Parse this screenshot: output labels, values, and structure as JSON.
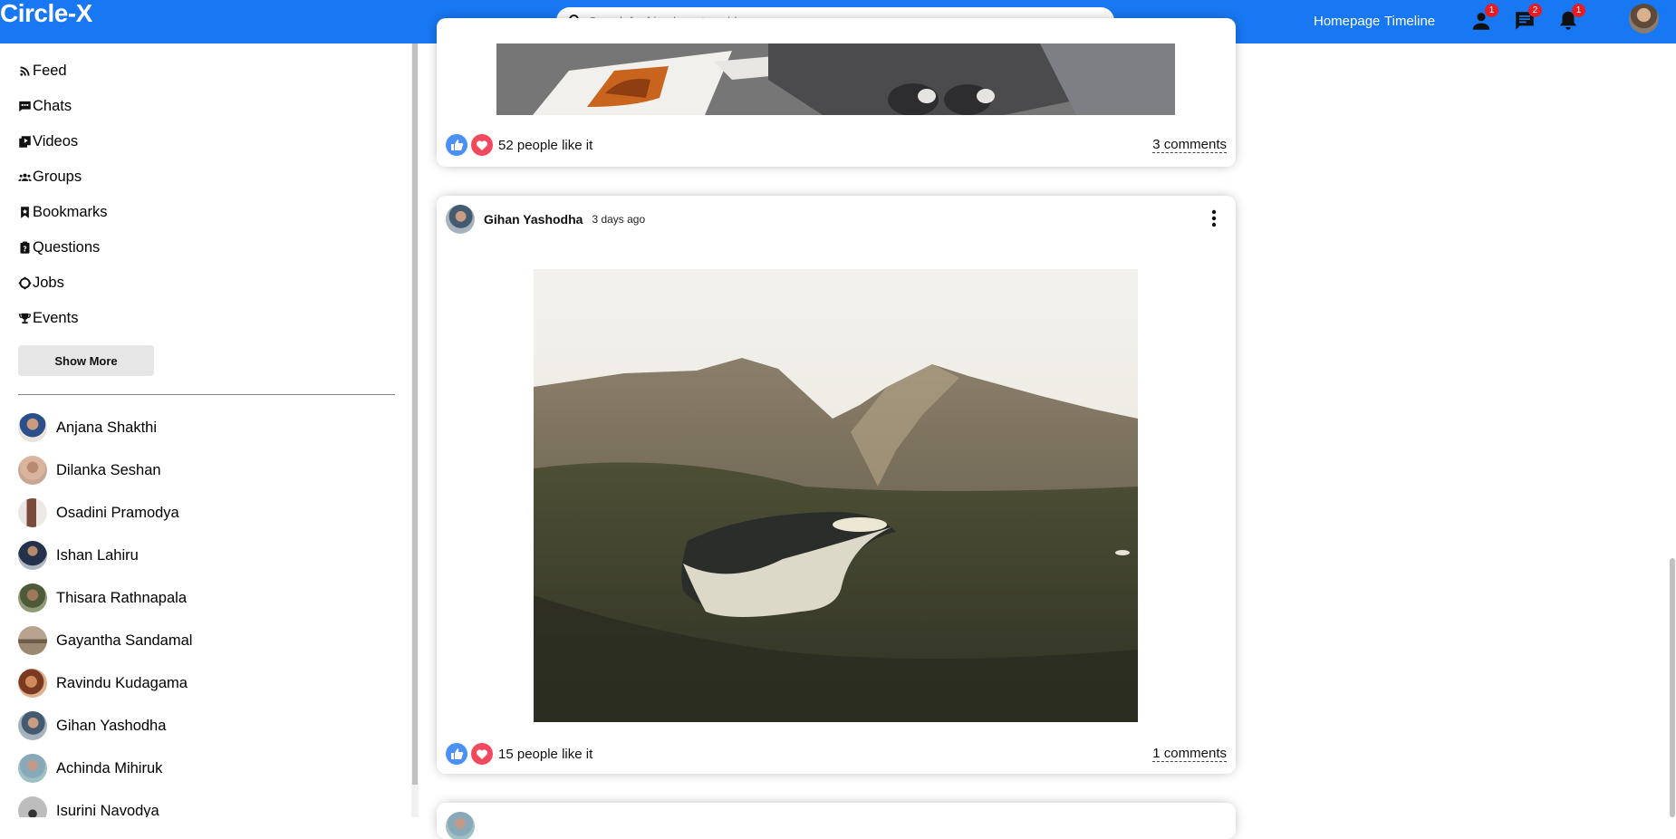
{
  "app": {
    "logo": "Circle-X"
  },
  "header": {
    "search_placeholder": "Search for friend, post or video",
    "links": [
      "Homepage",
      "Timeline"
    ],
    "badges": {
      "friends": "1",
      "messages": "2",
      "notifications": "1"
    },
    "icons": {
      "search": "search-icon",
      "friends": "person-icon",
      "messages": "chat-icon",
      "notifications": "bell-icon"
    }
  },
  "sidebar": {
    "nav": [
      {
        "label": "Feed",
        "icon": "rss-icon"
      },
      {
        "label": "Chats",
        "icon": "chat-icon"
      },
      {
        "label": "Videos",
        "icon": "video-library-icon"
      },
      {
        "label": "Groups",
        "icon": "group-icon"
      },
      {
        "label": "Bookmarks",
        "icon": "bookmark-icon"
      },
      {
        "label": "Questions",
        "icon": "question-icon"
      },
      {
        "label": "Jobs",
        "icon": "work-icon"
      },
      {
        "label": "Events",
        "icon": "trophy-icon"
      }
    ],
    "show_more_label": "Show More",
    "friends": [
      "Anjana Shakthi",
      "Dilanka Seshan",
      "Osadini Pramodya",
      "Ishan Lahiru",
      "Thisara Rathnapala",
      "Gayantha Sandamal",
      "Ravindu Kudagama",
      "Gihan Yashodha",
      "Achinda Mihiruk",
      "Isurini Navodya"
    ]
  },
  "posts": [
    {
      "likes_text": "52 people like it",
      "comments_text": "3 comments"
    },
    {
      "author": "Gihan Yashodha",
      "time": "3 days ago",
      "likes_text": "15 people like it",
      "comments_text": "1 comments"
    }
  ],
  "colors": {
    "brand": "#1877f2",
    "like": "#4a90f5",
    "heart": "#f2495c",
    "badge": "#e41e24"
  }
}
